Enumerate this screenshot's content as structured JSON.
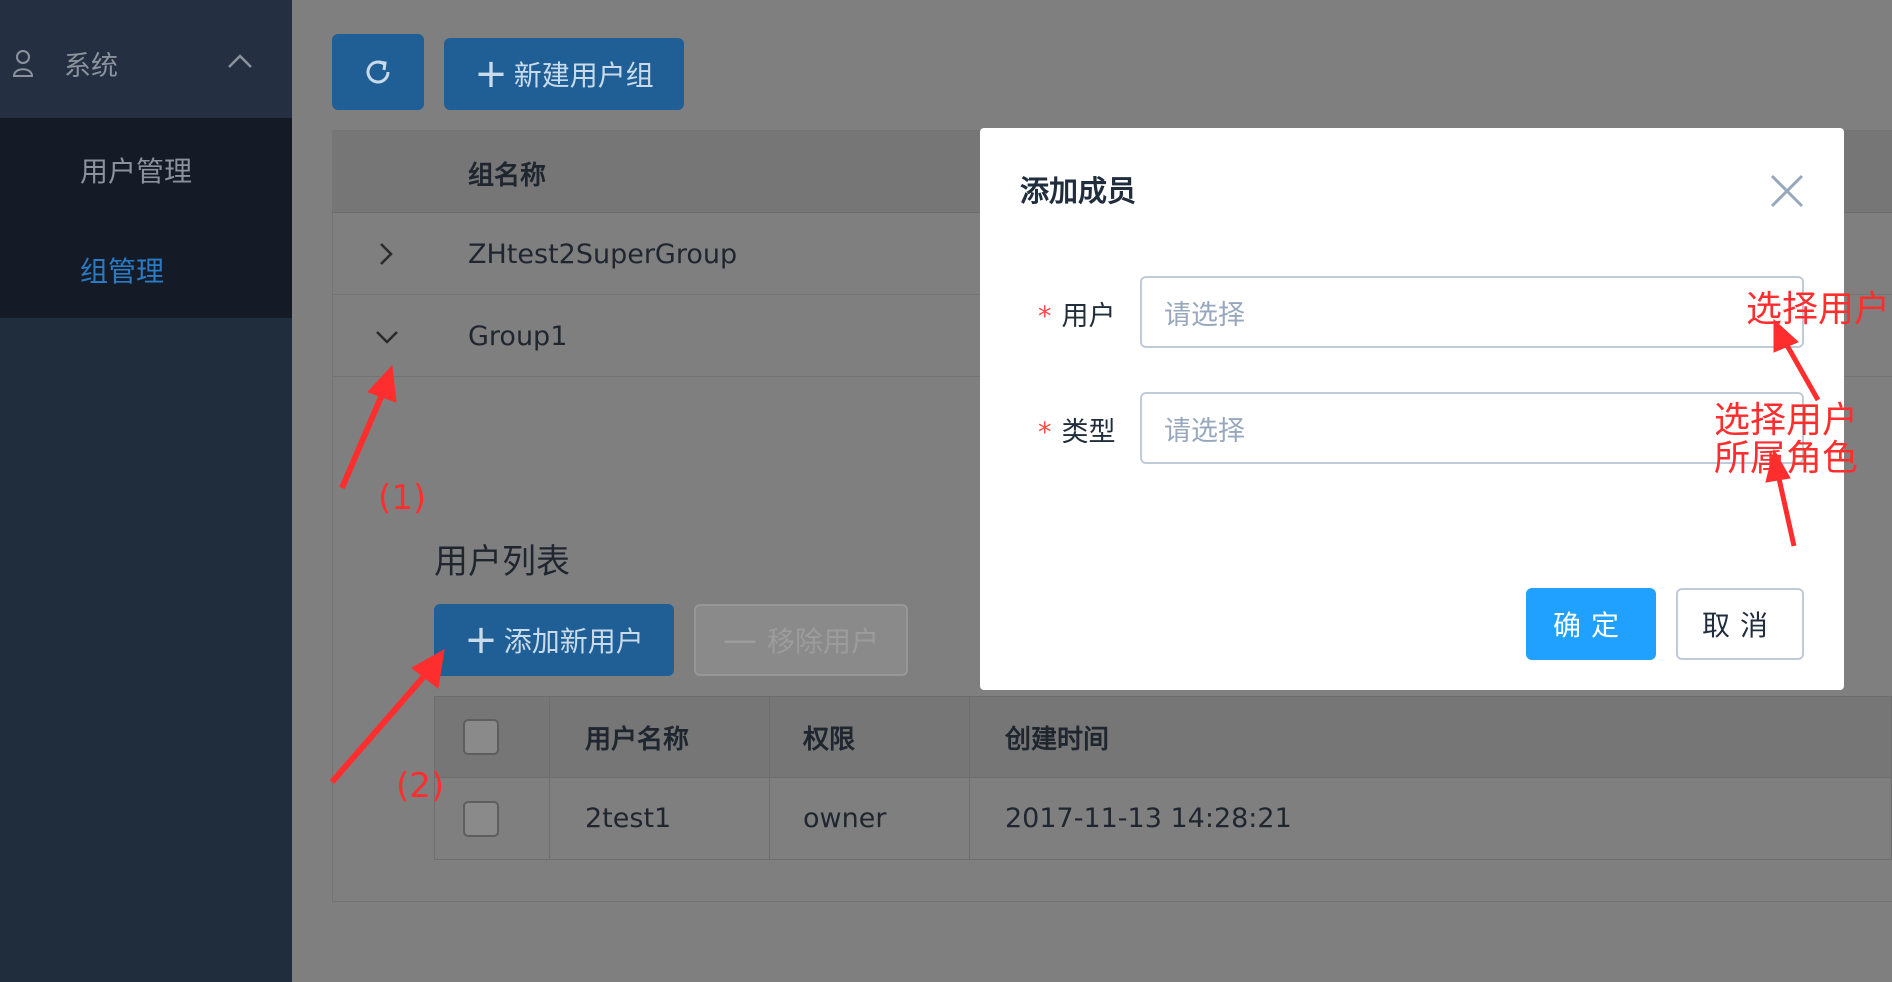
{
  "sidebar": {
    "section_label": "系统",
    "items": [
      {
        "label": "用户管理",
        "active": false
      },
      {
        "label": "组管理",
        "active": true
      }
    ]
  },
  "toolbar": {
    "refresh_icon": "refresh-icon",
    "new_group_label": "新建用户组"
  },
  "group_table": {
    "header": "组名称",
    "rows": [
      {
        "name": "ZHtest2SuperGroup",
        "expanded": false
      },
      {
        "name": "Group1",
        "expanded": true
      }
    ]
  },
  "user_list": {
    "title": "用户列表",
    "add_label": "添加新用户",
    "remove_label": "移除用户",
    "columns": [
      "用户名称",
      "权限",
      "创建时间"
    ],
    "rows": [
      {
        "name": "2test1",
        "permission": "owner",
        "created": "2017-11-13 14:28:21"
      }
    ]
  },
  "modal": {
    "title": "添加成员",
    "fields": [
      {
        "label": "用户",
        "placeholder": "请选择",
        "required": true
      },
      {
        "label": "类型",
        "placeholder": "请选择",
        "required": true
      }
    ],
    "ok_label": "确定",
    "cancel_label": "取消"
  },
  "annotations": {
    "step1": "(1)",
    "step2": "(2)",
    "select_user": "选择用户",
    "select_role_line1": "选择用户",
    "select_role_line2": "所属角色"
  },
  "colors": {
    "sidebar_bg": "#1f2d3d",
    "primary": "#20a0ff",
    "dimmed_primary": "#1f5f95",
    "annotation": "#ff2e2e",
    "required": "#ff4949"
  }
}
